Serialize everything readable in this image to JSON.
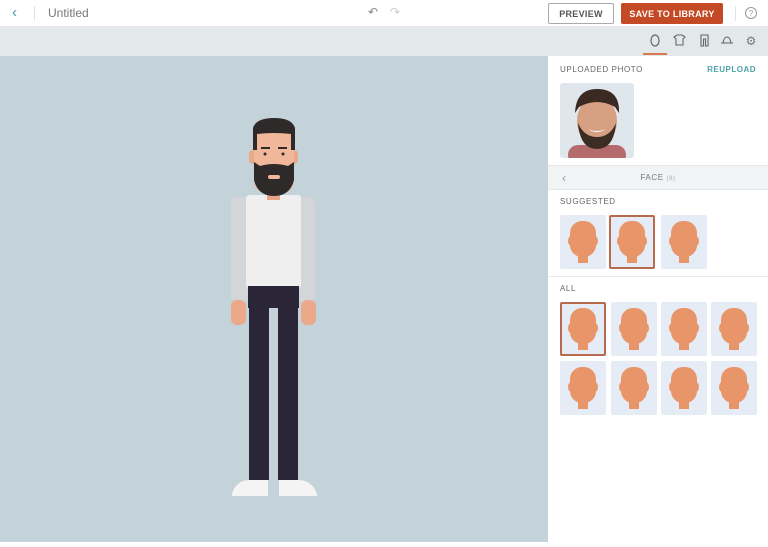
{
  "header": {
    "title": "Untitled",
    "preview_label": "PREVIEW",
    "save_label": "SAVE TO LIBRARY",
    "help_icon": "?"
  },
  "toolbar": {
    "tabs": [
      "face",
      "shirt",
      "pants",
      "hat",
      "settings"
    ],
    "active": "face"
  },
  "panel": {
    "uploaded_photo_label": "UPLOADED PHOTO",
    "reupload_label": "REUPLOAD",
    "section_title": "FACE",
    "section_count": "(8)",
    "suggested_label": "SUGGESTED",
    "all_label": "ALL",
    "suggested_selected": 1,
    "all_selected": 0
  },
  "colors": {
    "accent": "#c44a26",
    "skin": "#e8956a",
    "canvas": "#c3d3d9"
  }
}
